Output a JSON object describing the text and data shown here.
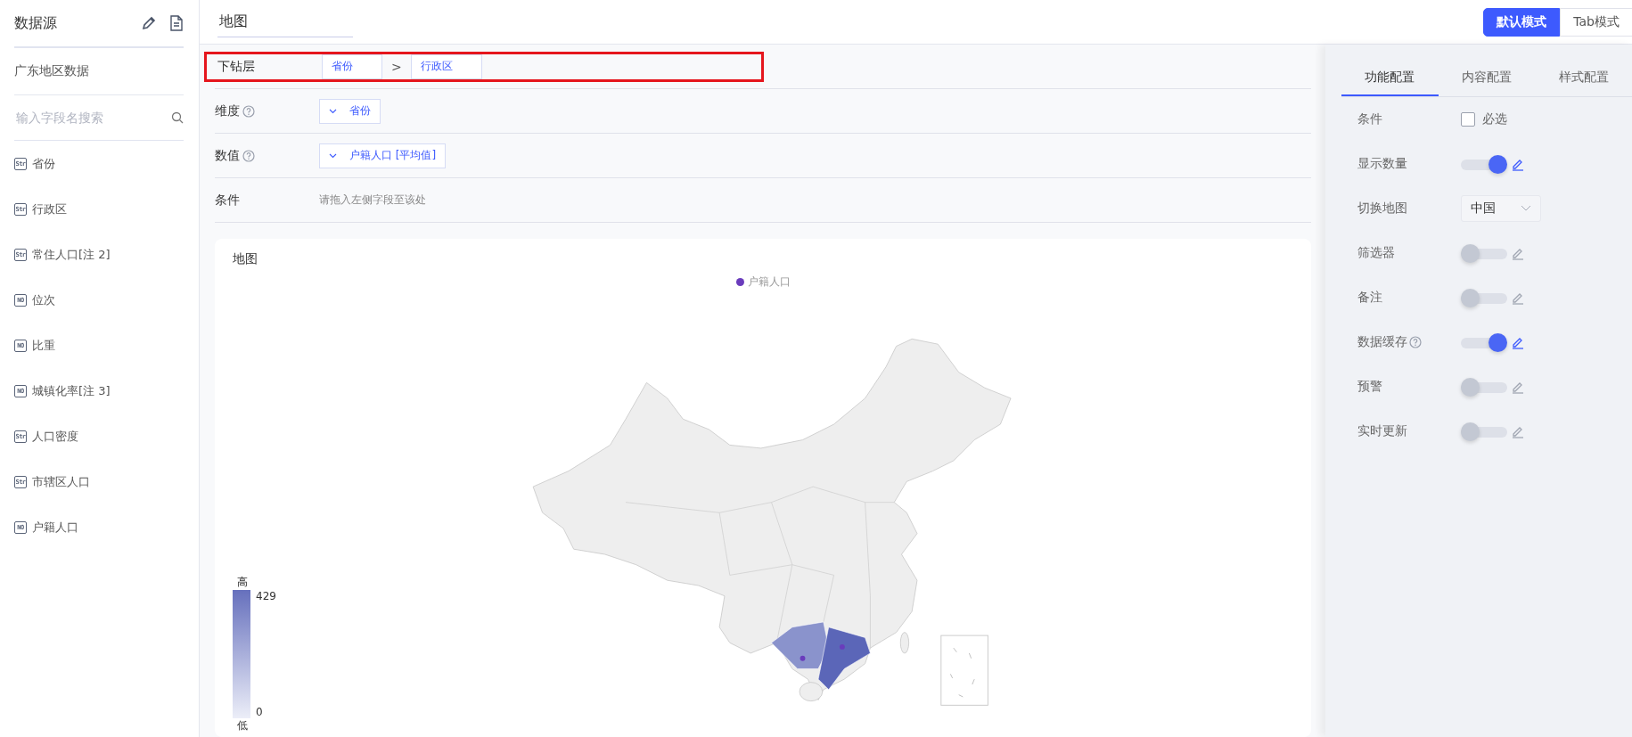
{
  "sidebar": {
    "title": "数据源",
    "dataset": "广东地区数据",
    "search": {
      "placeholder": "输入字段名搜索"
    },
    "fields": [
      {
        "badge": "Str",
        "name": "省份"
      },
      {
        "badge": "Str",
        "name": "行政区"
      },
      {
        "badge": "Str",
        "name": "常住人口[注 2]"
      },
      {
        "badge": "NO",
        "name": "位次"
      },
      {
        "badge": "NO",
        "name": "比重"
      },
      {
        "badge": "NO",
        "name": "城镇化率[注 3]"
      },
      {
        "badge": "Str",
        "name": "人口密度"
      },
      {
        "badge": "Str",
        "name": "市辖区人口"
      },
      {
        "badge": "NO",
        "name": "户籍人口"
      }
    ]
  },
  "header": {
    "title": "地图",
    "modes": [
      {
        "label": "默认模式",
        "selected": true
      },
      {
        "label": "Tab模式",
        "selected": false
      }
    ]
  },
  "config_rows": [
    {
      "kind": "drill",
      "label": "下钻层",
      "highlighted": true,
      "levels": [
        "省份",
        "行政区"
      ],
      "separator": ">"
    },
    {
      "kind": "field",
      "label": "维度",
      "help": true,
      "value": "省份"
    },
    {
      "kind": "field",
      "label": "数值",
      "help": true,
      "value": "户籍人口 [平均值]"
    },
    {
      "kind": "hint",
      "label": "条件",
      "hint": "请拖入左侧字段至该处"
    }
  ],
  "chart": {
    "title": "地图",
    "legend": {
      "label": "户籍人口",
      "color": "#6a3cbc"
    },
    "visual_map": {
      "high_label": "高",
      "max": "429",
      "min": "0",
      "low_label": "低"
    }
  },
  "panel": {
    "tabs": [
      {
        "label": "功能配置",
        "selected": true
      },
      {
        "label": "内容配置",
        "selected": false
      },
      {
        "label": "样式配置",
        "selected": false
      }
    ],
    "settings": [
      {
        "kind": "checkbox",
        "label": "条件",
        "option": "必选",
        "checked": false
      },
      {
        "kind": "toggle",
        "label": "显示数量",
        "on": true
      },
      {
        "kind": "select",
        "label": "切换地图",
        "value": "中国"
      },
      {
        "kind": "toggle",
        "label": "筛选器",
        "on": false
      },
      {
        "kind": "toggle",
        "label": "备注",
        "on": false
      },
      {
        "kind": "toggle",
        "label": "数据缓存",
        "help": true,
        "on": true
      },
      {
        "kind": "toggle",
        "label": "预警",
        "on": false
      },
      {
        "kind": "toggle",
        "label": "实时更新",
        "on": false
      }
    ]
  }
}
